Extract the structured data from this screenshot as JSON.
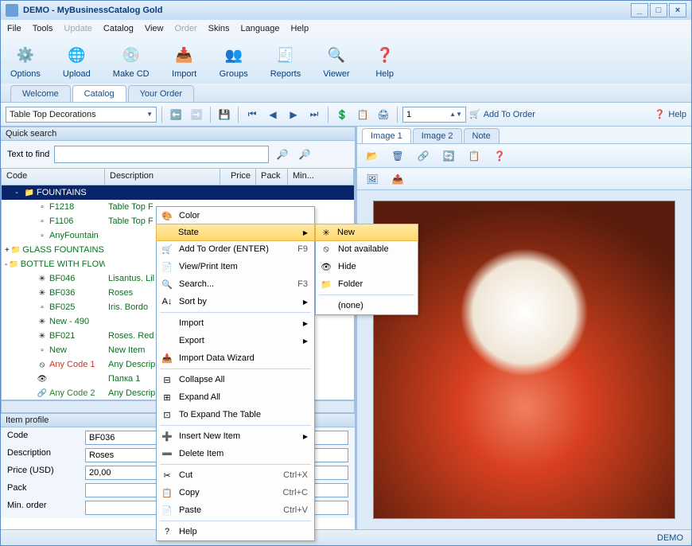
{
  "title": "DEMO - MyBusinessCatalog Gold",
  "menus": {
    "file": "File",
    "tools": "Tools",
    "update": "Update",
    "catalog": "Catalog",
    "view": "View",
    "order": "Order",
    "skins": "Skins",
    "language": "Language",
    "help": "Help"
  },
  "toolbar": {
    "options": "Options",
    "upload": "Upload",
    "makecd": "Make CD",
    "import": "Import",
    "groups": "Groups",
    "reports": "Reports",
    "viewer": "Viewer",
    "help": "Help"
  },
  "tabs": {
    "welcome": "Welcome",
    "catalog": "Catalog",
    "yourorder": "Your Order"
  },
  "secondbar": {
    "groupcombo": "Table Top Decorations",
    "qty": "1",
    "addtoorder": "Add To Order",
    "help": "Help"
  },
  "quicksearch": {
    "title": "Quick search",
    "label": "Text to find",
    "value": ""
  },
  "gridhead": {
    "code": "Code",
    "description": "Description",
    "price": "Price",
    "pack": "Pack",
    "min": "Min..."
  },
  "tree": [
    {
      "indent": 0,
      "exp": "-",
      "icon": "folder",
      "code": "FOUNTAINS",
      "desc": "",
      "sel": true
    },
    {
      "indent": 1,
      "exp": "",
      "icon": "doc",
      "code": "F1218",
      "desc": "Table Top F"
    },
    {
      "indent": 1,
      "exp": "",
      "icon": "doc",
      "code": "F1106",
      "desc": "Table Top F"
    },
    {
      "indent": 1,
      "exp": "",
      "icon": "doc",
      "code": "AnyFountain",
      "desc": ""
    },
    {
      "indent": 1,
      "exp": "+",
      "icon": "folder",
      "code": "GLASS FOUNTAINS",
      "desc": ""
    },
    {
      "indent": 0,
      "exp": "-",
      "icon": "folder",
      "code": "BOTTLE WITH FLOWERS",
      "desc": ""
    },
    {
      "indent": 1,
      "exp": "",
      "icon": "new",
      "code": "BF046",
      "desc": "Lisantus. Lil"
    },
    {
      "indent": 1,
      "exp": "",
      "icon": "new",
      "code": "BF036",
      "desc": "Roses"
    },
    {
      "indent": 1,
      "exp": "",
      "icon": "doc",
      "code": "BF025",
      "desc": "Iris. Bordo"
    },
    {
      "indent": 1,
      "exp": "",
      "icon": "new",
      "code": "New - 490",
      "desc": ""
    },
    {
      "indent": 1,
      "exp": "",
      "icon": "new",
      "code": "BF021",
      "desc": "Roses. Red"
    },
    {
      "indent": 1,
      "exp": "",
      "icon": "doc",
      "code": "New",
      "desc": "New Item"
    },
    {
      "indent": 1,
      "exp": "",
      "icon": "no",
      "code": "Any Code 1",
      "desc": "Any Descrip"
    },
    {
      "indent": 1,
      "exp": "",
      "icon": "hide",
      "code": "",
      "desc": "Папка 1"
    },
    {
      "indent": 1,
      "exp": "",
      "icon": "link",
      "code": "Any Code 2",
      "desc": "Any Descrip"
    }
  ],
  "profile": {
    "title": "Item profile",
    "code_l": "Code",
    "code_v": "BF036",
    "desc_l": "Description",
    "desc_v": "Roses",
    "price_l": "Price (USD)",
    "price_v": "20,00",
    "pack_l": "Pack",
    "pack_v": "",
    "min_l": "Min. order",
    "min_v": ""
  },
  "rtabs": {
    "img1": "Image 1",
    "img2": "Image 2",
    "note": "Note"
  },
  "ctx": {
    "main": [
      {
        "ic": "🎨",
        "t": "Color"
      },
      {
        "ic": "",
        "t": "State",
        "sub": true,
        "hl": true
      },
      {
        "ic": "🛒",
        "t": "Add To Order (ENTER)",
        "sc": "F9"
      },
      {
        "ic": "📄",
        "t": "View/Print Item"
      },
      {
        "ic": "🔍",
        "t": "Search...",
        "sc": "F3"
      },
      {
        "ic": "A↓",
        "t": "Sort by",
        "sub": true
      },
      {
        "sep": true
      },
      {
        "ic": "",
        "t": "Import",
        "sub": true
      },
      {
        "ic": "",
        "t": "Export",
        "sub": true
      },
      {
        "ic": "📥",
        "t": "Import Data Wizard"
      },
      {
        "sep": true
      },
      {
        "ic": "⊟",
        "t": "Collapse All"
      },
      {
        "ic": "⊞",
        "t": "Expand All"
      },
      {
        "ic": "⊡",
        "t": "To Expand The Table"
      },
      {
        "sep": true
      },
      {
        "ic": "➕",
        "t": "Insert New Item",
        "sub": true
      },
      {
        "ic": "➖",
        "t": "Delete Item"
      },
      {
        "sep": true
      },
      {
        "ic": "✂",
        "t": "Cut",
        "sc": "Ctrl+X"
      },
      {
        "ic": "📋",
        "t": "Copy",
        "sc": "Ctrl+C"
      },
      {
        "ic": "📄",
        "t": "Paste",
        "sc": "Ctrl+V"
      },
      {
        "sep": true
      },
      {
        "ic": "?",
        "t": "Help"
      }
    ],
    "sub": [
      {
        "ic": "✳",
        "t": "New",
        "hl": true
      },
      {
        "ic": "⦸",
        "t": "Not available"
      },
      {
        "ic": "👁",
        "t": "Hide"
      },
      {
        "ic": "📁",
        "t": "Folder"
      },
      {
        "sep": true
      },
      {
        "ic": "",
        "t": "(none)"
      }
    ]
  },
  "status": "DEMO"
}
